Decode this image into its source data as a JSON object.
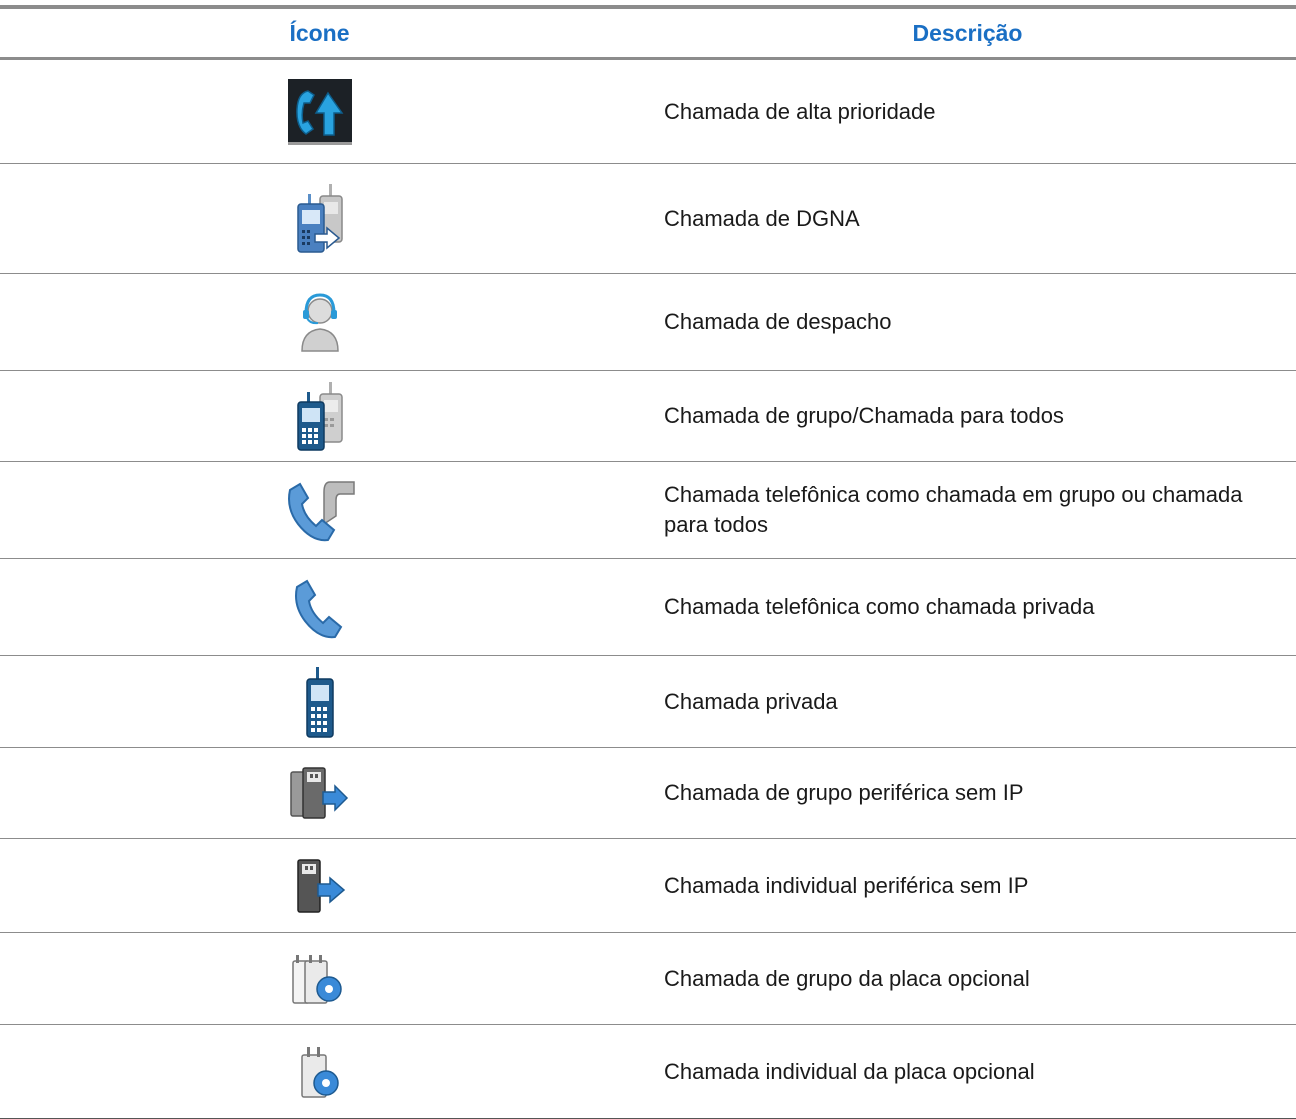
{
  "table": {
    "headers": {
      "icon": "Ícone",
      "description": "Descrição"
    },
    "rows": [
      {
        "icon": "high-priority-call-icon",
        "description": "Chamada de alta prioridade"
      },
      {
        "icon": "dgna-call-icon",
        "description": "Chamada de DGNA"
      },
      {
        "icon": "dispatch-call-icon",
        "description": "Chamada de despacho"
      },
      {
        "icon": "group-call-icon",
        "description": "Chamada de grupo/Chamada para todos"
      },
      {
        "icon": "phone-group-call-icon",
        "description": "Chamada telefônica como chamada em grupo ou chamada para todos"
      },
      {
        "icon": "phone-private-call-icon",
        "description": "Chamada telefônica como chamada privada"
      },
      {
        "icon": "private-call-icon",
        "description": "Chamada privada"
      },
      {
        "icon": "non-ip-peripheral-group-call-icon",
        "description": "Chamada de grupo periférica sem IP"
      },
      {
        "icon": "non-ip-peripheral-individual-call-icon",
        "description": "Chamada individual periférica sem IP"
      },
      {
        "icon": "option-board-group-call-icon",
        "description": "Chamada de grupo da placa opcional"
      },
      {
        "icon": "option-board-individual-call-icon",
        "description": "Chamada individual da placa opcional"
      }
    ]
  },
  "colors": {
    "header_text": "#1a6fc4",
    "rule": "#8c8c8c",
    "icon_blue": "#4a90d6"
  }
}
